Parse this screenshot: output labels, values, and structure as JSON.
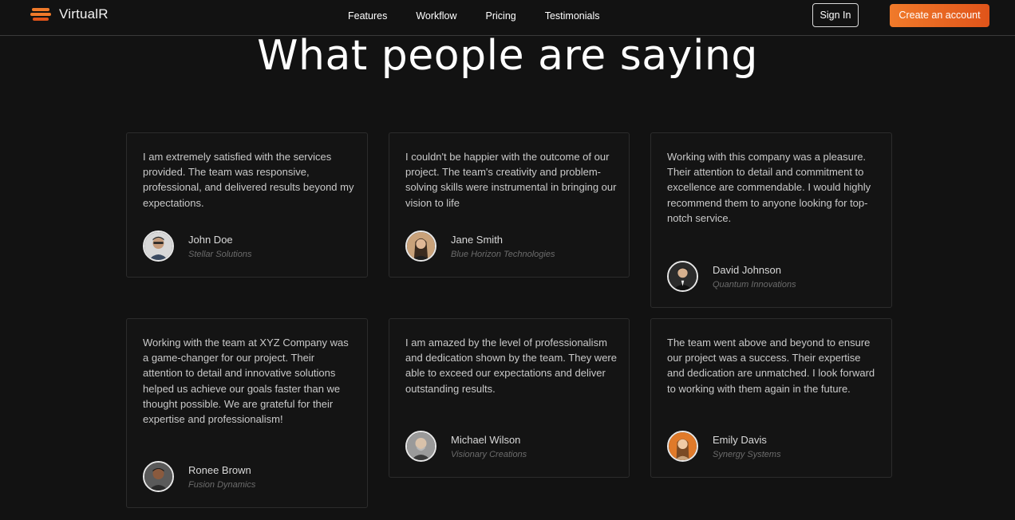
{
  "brand": {
    "name": "VirtualR",
    "accent": "#f07a2a"
  },
  "nav": {
    "links": [
      "Features",
      "Workflow",
      "Pricing",
      "Testimonials"
    ],
    "sign_in": "Sign In",
    "create_account": "Create an account"
  },
  "section": {
    "title": "What people are saying"
  },
  "testimonials": [
    {
      "quote": "I am extremely satisfied with the services provided. The team was responsive, professional, and delivered results beyond my expectations.",
      "name": "John Doe",
      "company": "Stellar Solutions",
      "avatar": "user-avatar"
    },
    {
      "quote": "I couldn't be happier with the outcome of our project. The team's creativity and problem-solving skills were instrumental in bringing our vision to life",
      "name": "Jane Smith",
      "company": "Blue Horizon Technologies",
      "avatar": "user-avatar"
    },
    {
      "quote": "Working with this company was a pleasure. Their attention to detail and commitment to excellence are commendable. I would highly recommend them to anyone looking for top-notch service.",
      "name": "David Johnson",
      "company": "Quantum Innovations",
      "avatar": "user-avatar"
    },
    {
      "quote": "Working with the team at XYZ Company was a game-changer for our project. Their attention to detail and innovative solutions helped us achieve our goals faster than we thought possible. We are grateful for their expertise and professionalism!",
      "name": "Ronee Brown",
      "company": "Fusion Dynamics",
      "avatar": "user-avatar"
    },
    {
      "quote": "I am amazed by the level of professionalism and dedication shown by the team. They were able to exceed our expectations and deliver outstanding results.",
      "name": "Michael Wilson",
      "company": "Visionary Creations",
      "avatar": "user-avatar"
    },
    {
      "quote": "The team went above and beyond to ensure our project was a success. Their expertise and dedication are unmatched. I look forward to working with them again in the future.",
      "name": "Emily Davis",
      "company": "Synergy Systems",
      "avatar": "user-avatar"
    }
  ]
}
